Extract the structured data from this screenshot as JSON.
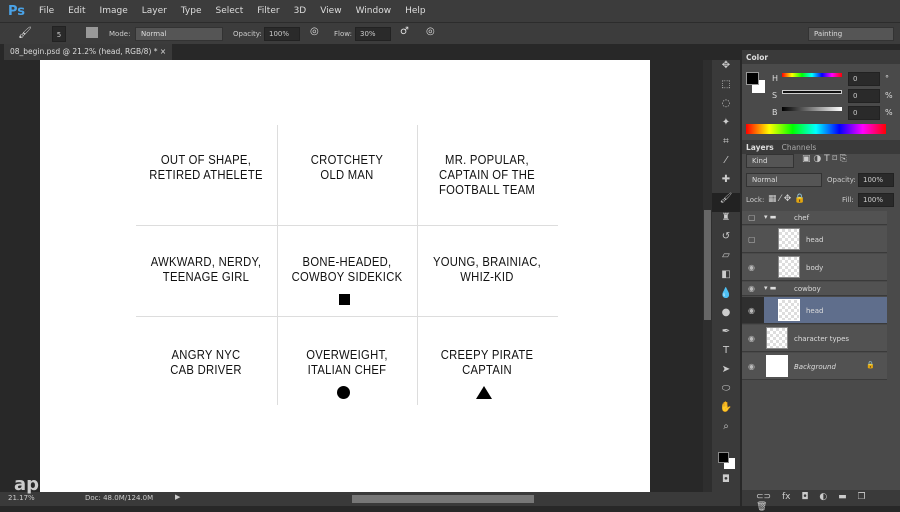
{
  "app": {
    "logo": "Ps",
    "menu": [
      "File",
      "Edit",
      "Image",
      "Layer",
      "Type",
      "Select",
      "Filter",
      "3D",
      "View",
      "Window",
      "Help"
    ]
  },
  "options": {
    "brush_size": "5",
    "mode_label": "Mode:",
    "mode": "Normal",
    "opacity_label": "Opacity:",
    "opacity": "100%",
    "flow_label": "Flow:",
    "flow": "30%",
    "workspace": "Painting"
  },
  "tab": {
    "title": "08_begin.psd @ 21.2% (head, RGB/8) *",
    "close": "×"
  },
  "canvas": {
    "cells": [
      [
        "OUT OF SHAPE,",
        "RETIRED ATHELETE"
      ],
      [
        "CROTCHETY",
        "OLD MAN"
      ],
      [
        "MR. POPULAR,",
        "CAPTAIN OF THE",
        "FOOTBALL TEAM"
      ],
      [
        "AWKWARD, NERDY,",
        "TEENAGE GIRL"
      ],
      [
        "BONE-HEADED,",
        "COWBOY SIDEKICK"
      ],
      [
        "YOUNG, BRAINIAC,",
        "WHIZ-KID"
      ],
      [
        "ANGRY NYC",
        "CAB DRIVER"
      ],
      [
        "OVERWEIGHT,",
        "ITALIAN CHEF"
      ],
      [
        "CREEPY PIRATE",
        "CAPTAIN"
      ]
    ]
  },
  "status": {
    "zoom": "21.17%",
    "doc": "Doc: 48.0M/124.0M",
    "watermark": "ap"
  },
  "color_panel": {
    "title": "Color",
    "h_label": "H",
    "h": "0",
    "h_unit": "°",
    "s_label": "S",
    "s": "0",
    "s_unit": "%",
    "b_label": "B",
    "b": "0",
    "b_unit": "%"
  },
  "layers_panel": {
    "tabs": [
      "Layers",
      "Channels"
    ],
    "filter": "Kind",
    "blend": "Normal",
    "opacity_label": "Opacity:",
    "opacity": "100%",
    "lock_label": "Lock:",
    "fill_label": "Fill:",
    "fill": "100%",
    "layers": [
      {
        "name": "chef",
        "type": "group",
        "visible": false
      },
      {
        "name": "head",
        "type": "layer",
        "visible": false
      },
      {
        "name": "body",
        "type": "layer",
        "visible": true
      },
      {
        "name": "cowboy",
        "type": "group",
        "visible": true
      },
      {
        "name": "head",
        "type": "layer",
        "visible": true,
        "selected": true
      },
      {
        "name": "character types",
        "type": "layer",
        "visible": true
      },
      {
        "name": "Background",
        "type": "background",
        "visible": true,
        "locked": true
      }
    ]
  },
  "colors": {
    "selected_layer": "#5f6e8c",
    "panel": "#4a4a4a"
  }
}
